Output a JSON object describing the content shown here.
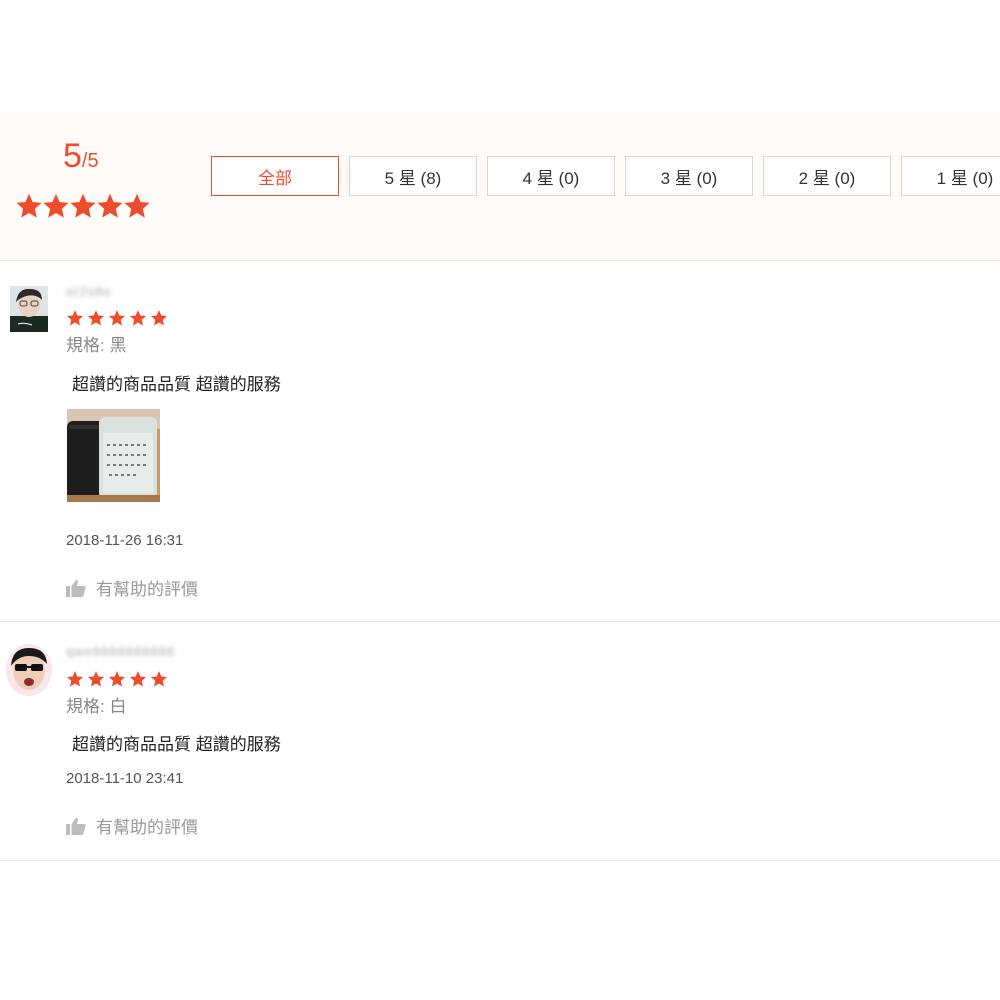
{
  "summary": {
    "score": "5",
    "score_suffix": "/5",
    "rating_stars": 5,
    "filters": [
      {
        "label": "全部",
        "active": true
      },
      {
        "label": "5 星 (8)",
        "active": false
      },
      {
        "label": "4 星 (0)",
        "active": false
      },
      {
        "label": "3 星 (0)",
        "active": false
      },
      {
        "label": "2 星 (0)",
        "active": false
      },
      {
        "label": "1 星 (0)",
        "active": false
      }
    ]
  },
  "reviews": [
    {
      "username": "or2s8o",
      "rating": 5,
      "spec": "規格: 黑",
      "comment": "超讚的商品品質 超讚的服務",
      "has_photo": true,
      "date": "2018-11-26 16:31",
      "helpful_label": "有幫助的評價"
    },
    {
      "username": "qwe8888888888",
      "rating": 5,
      "spec": "規格: 白",
      "comment": "超讚的商品品質 超讚的服務",
      "has_photo": false,
      "date": "2018-11-10 23:41",
      "helpful_label": "有幫助的評價"
    }
  ],
  "colors": {
    "accent": "#ee4d2d",
    "summary_bg": "#fffbf8"
  },
  "icons": {
    "star": "star-icon",
    "helpful": "thumbs-up-icon"
  }
}
